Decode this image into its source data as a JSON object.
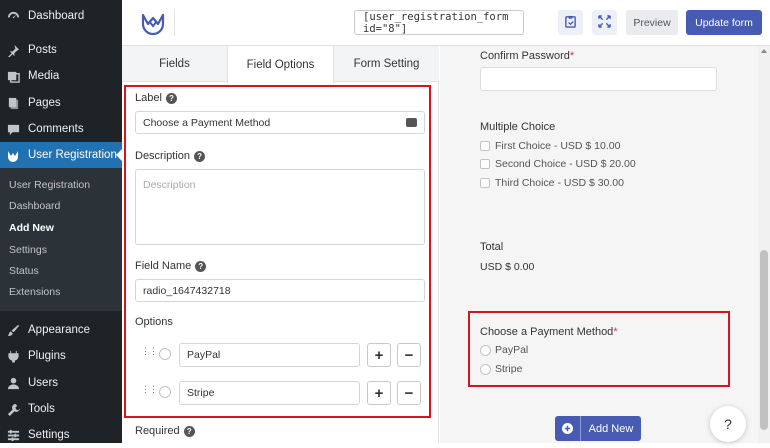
{
  "sidebar": {
    "items": [
      {
        "label": "Dashboard",
        "icon": "dashboard-icon"
      },
      {
        "label": "Posts",
        "icon": "pin-icon"
      },
      {
        "label": "Media",
        "icon": "media-icon"
      },
      {
        "label": "Pages",
        "icon": "pages-icon"
      },
      {
        "label": "Comments",
        "icon": "comment-icon"
      },
      {
        "label": "User Registration",
        "icon": "user-registration-icon"
      }
    ],
    "submenu": [
      "User Registration",
      "Dashboard",
      "Add New",
      "Settings",
      "Status",
      "Extensions"
    ],
    "lower_items": [
      {
        "label": "Appearance",
        "icon": "brush-icon"
      },
      {
        "label": "Plugins",
        "icon": "plug-icon"
      },
      {
        "label": "Users",
        "icon": "users-icon"
      },
      {
        "label": "Tools",
        "icon": "wrench-icon"
      },
      {
        "label": "Settings",
        "icon": "settings-icon"
      }
    ]
  },
  "topbar": {
    "shortcode": "[user_registration_form id=\"8\"]",
    "preview_label": "Preview",
    "update_label": "Update form"
  },
  "tabs": [
    "Fields",
    "Field Options",
    "Form Setting"
  ],
  "field_options": {
    "label_heading": "Label",
    "label_value": "Choose a Payment Method",
    "description_heading": "Description",
    "description_placeholder": "Description",
    "field_name_heading": "Field Name",
    "field_name_value": "radio_1647432718",
    "options_heading": "Options",
    "options": [
      "PayPal",
      "Stripe"
    ],
    "required_heading": "Required"
  },
  "preview": {
    "confirm_password_label": "Confirm Password",
    "multiple_choice_label": "Multiple Choice",
    "choices": [
      "First Choice - USD $ 10.00",
      "Second Choice - USD $ 20.00",
      "Third Choice - USD $ 30.00"
    ],
    "total_label": "Total",
    "total_value": "USD $ 0.00",
    "payment_label": "Choose a Payment Method",
    "payment_options": [
      "PayPal",
      "Stripe"
    ],
    "add_new_label": "Add New",
    "required_mark": "*"
  },
  "colors": {
    "accent": "#475bb2",
    "highlight": "#d6141e",
    "wp_active": "#2271b1"
  }
}
